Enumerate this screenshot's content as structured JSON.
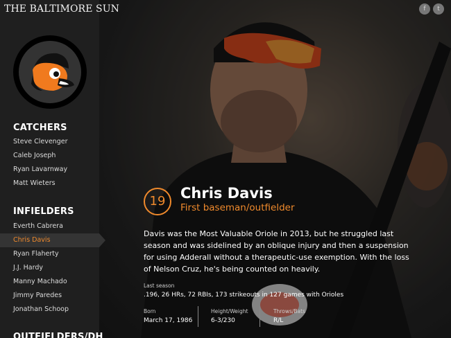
{
  "masthead": "THE BALTIMORE SUN",
  "social": {
    "facebook_icon": "f",
    "twitter_icon": "t"
  },
  "sidebar": {
    "sections": [
      {
        "title": "CATCHERS",
        "items": [
          "Steve Clevenger",
          "Caleb Joseph",
          "Ryan Lavarnway",
          "Matt Wieters"
        ]
      },
      {
        "title": "INFIELDERS",
        "items": [
          "Everth Cabrera",
          "Chris Davis",
          "Ryan Flaherty",
          "J.J. Hardy",
          "Manny Machado",
          "Jimmy Paredes",
          "Jonathan Schoop"
        ]
      },
      {
        "title": "OUTFIELDERS/DH",
        "items": []
      }
    ],
    "active_item": "Chris Davis"
  },
  "player": {
    "number": "19",
    "name": "Chris Davis",
    "position": "First baseman/outfielder",
    "bio": "Davis was the Most Valuable Oriole in 2013, but he struggled last season and was sidelined by an oblique injury and then a suspension for using Adderall without a therapeutic-use exemption. With the loss of Nelson Cruz, he's being counted on heavily.",
    "last_season_label": "Last season",
    "last_season_value": ".196, 26 HRs, 72 RBIs, 173 strikeouts in 127 games with Orioles",
    "born_label": "Born",
    "born_value": "March 17, 1986",
    "hw_label": "Height/Weight",
    "hw_value": "6-3/230",
    "tb_label": "Throws/Bats",
    "tb_value": "R/L"
  },
  "colors": {
    "accent": "#f08a2c",
    "sidebar_bg": "#1f1f1f",
    "active_bg": "#343434"
  }
}
